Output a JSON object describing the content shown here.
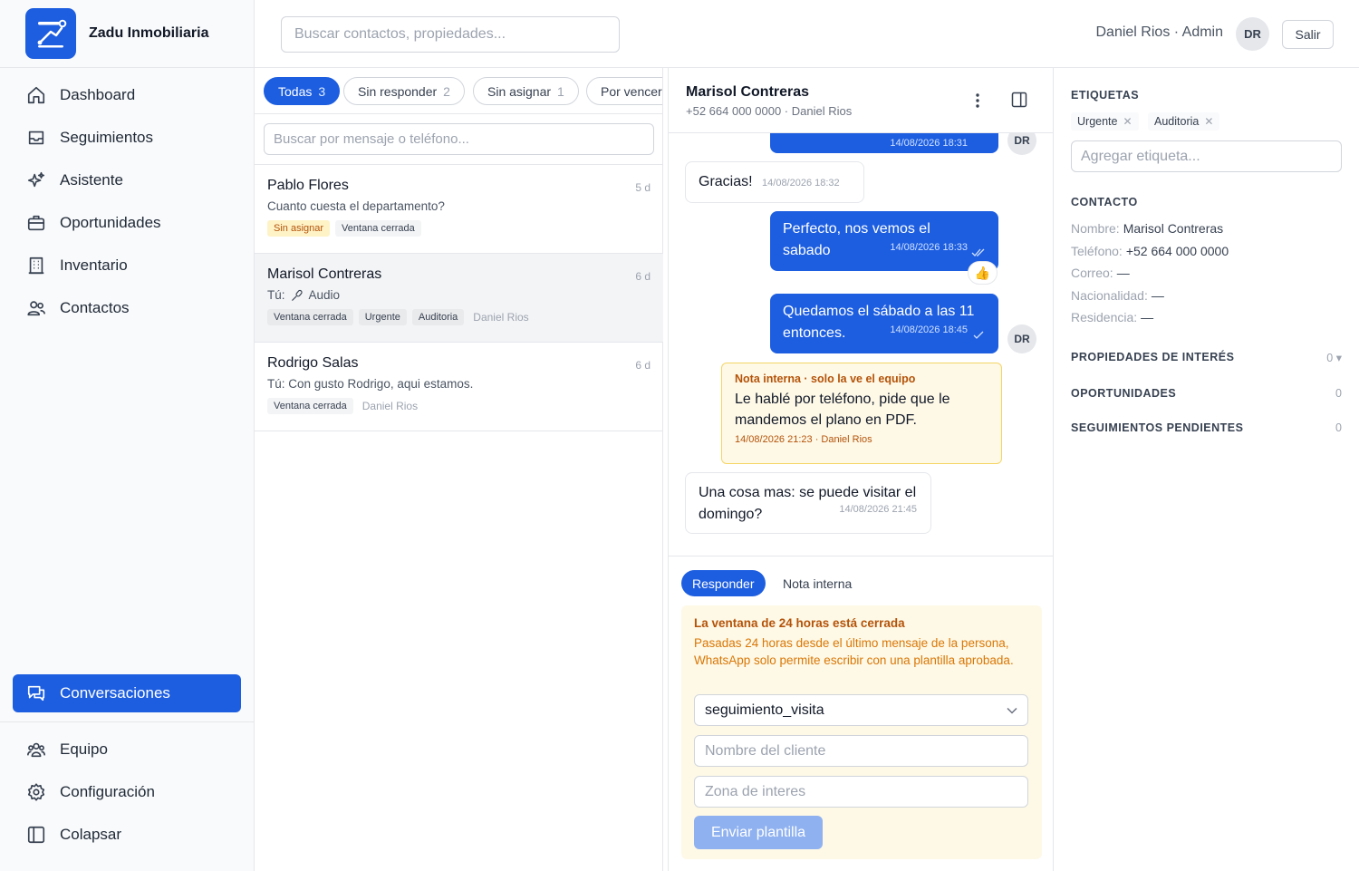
{
  "brand": {
    "name": "Zadu Inmobiliaria"
  },
  "sidebar": {
    "items": [
      {
        "label": "Dashboard",
        "icon": "home-icon"
      },
      {
        "label": "Seguimientos",
        "icon": "inbox-icon"
      },
      {
        "label": "Asistente",
        "icon": "sparkles-icon"
      },
      {
        "label": "Oportunidades",
        "icon": "briefcase-icon"
      },
      {
        "label": "Inventario",
        "icon": "building-icon"
      },
      {
        "label": "Contactos",
        "icon": "users-icon"
      }
    ],
    "active_item": {
      "label": "Conversaciones",
      "icon": "chat-icon"
    },
    "bottom_items": [
      {
        "label": "Equipo",
        "icon": "team-icon"
      },
      {
        "label": "Configuración",
        "icon": "gear-icon"
      },
      {
        "label": "Colapsar",
        "icon": "collapse-icon"
      }
    ]
  },
  "topbar": {
    "search_placeholder": "Buscar contactos, propiedades...",
    "user_label": "Daniel Rios · Admin",
    "avatar_initials": "DR",
    "logout_label": "Salir"
  },
  "conv_list": {
    "filters": [
      {
        "label": "Todas",
        "count": "3",
        "active": true
      },
      {
        "label": "Sin responder",
        "count": "2"
      },
      {
        "label": "Sin asignar",
        "count": "1"
      },
      {
        "label": "Por vencer",
        "count": ""
      }
    ],
    "search_placeholder": "Buscar por mensaje o teléfono...",
    "rows": [
      {
        "name": "Pablo Flores",
        "age": "5 d",
        "preview": "Cuanto cuesta el departamento?",
        "tags": [
          "Sin asignar",
          "Ventana cerrada"
        ],
        "assignee": ""
      },
      {
        "name": "Marisol Contreras",
        "age": "6 d",
        "preview_prefix": "Tú:",
        "preview": "Audio",
        "tags": [
          "Ventana cerrada",
          "Urgente",
          "Auditoria"
        ],
        "assignee": "Daniel Rios"
      },
      {
        "name": "Rodrigo Salas",
        "age": "6 d",
        "preview": "Tú: Con gusto Rodrigo, aqui estamos.",
        "tags": [
          "Ventana cerrada"
        ],
        "assignee": "Daniel Rios"
      }
    ]
  },
  "chat": {
    "contact_name": "Marisol Contreras",
    "contact_sub": "+52 664 000 0000 · Daniel Rios",
    "messages": [
      {
        "dir": "out",
        "text": "",
        "time": "14/08/2026 18:31"
      },
      {
        "dir": "in",
        "text": "Gracias!",
        "time": "14/08/2026 18:32"
      },
      {
        "dir": "out",
        "text": "Perfecto, nos vemos el sabado",
        "time": "14/08/2026 18:33",
        "reaction": "👍"
      },
      {
        "dir": "out",
        "text": "Quedamos el sábado a las 11 entonces.",
        "time": "14/08/2026 18:45"
      },
      {
        "dir": "in",
        "text": "Una cosa mas: se puede visitar el domingo?",
        "time": "14/08/2026 21:45"
      }
    ],
    "agent_initials": "DR",
    "note": {
      "title": "Nota interna · solo la ve el equipo",
      "body": "Le hablé por teléfono, pide que le mandemos el plano en PDF.",
      "meta": "14/08/2026 21:23 · Daniel Rios"
    }
  },
  "composer": {
    "tab_reply": "Responder",
    "tab_note": "Nota interna",
    "window_title": "La ventana de 24 horas está cerrada",
    "window_desc": "Pasadas 24 horas desde el último mensaje de la persona, WhatsApp solo permite escribir con una plantilla aprobada.",
    "template_selected": "seguimiento_visita",
    "field1_placeholder": "Nombre del cliente",
    "field2_placeholder": "Zona de interes",
    "send_label": "Enviar plantilla"
  },
  "details": {
    "labels_title": "ETIQUETAS",
    "labels": [
      "Urgente",
      "Auditoria"
    ],
    "tag_input_placeholder": "Agregar etiqueta...",
    "contact_title": "CONTACTO",
    "contact_fields": [
      {
        "k": "Nombre:",
        "v": "Marisol Contreras"
      },
      {
        "k": "Teléfono:",
        "v": "+52 664 000 0000"
      },
      {
        "k": "Correo:",
        "v": "—"
      },
      {
        "k": "Nacionalidad:",
        "v": "—"
      },
      {
        "k": "Residencia:",
        "v": "—"
      }
    ],
    "sections": [
      {
        "title": "PROPIEDADES DE INTERÉS",
        "count": "0 ▾"
      },
      {
        "title": "OPORTUNIDADES",
        "count": "0"
      },
      {
        "title": "SEGUIMIENTOS PENDIENTES",
        "count": "0"
      }
    ]
  },
  "colors": {
    "primary": "#1d5ee0",
    "warning_bg": "#fef9e7",
    "warning_text": "#b45309"
  }
}
